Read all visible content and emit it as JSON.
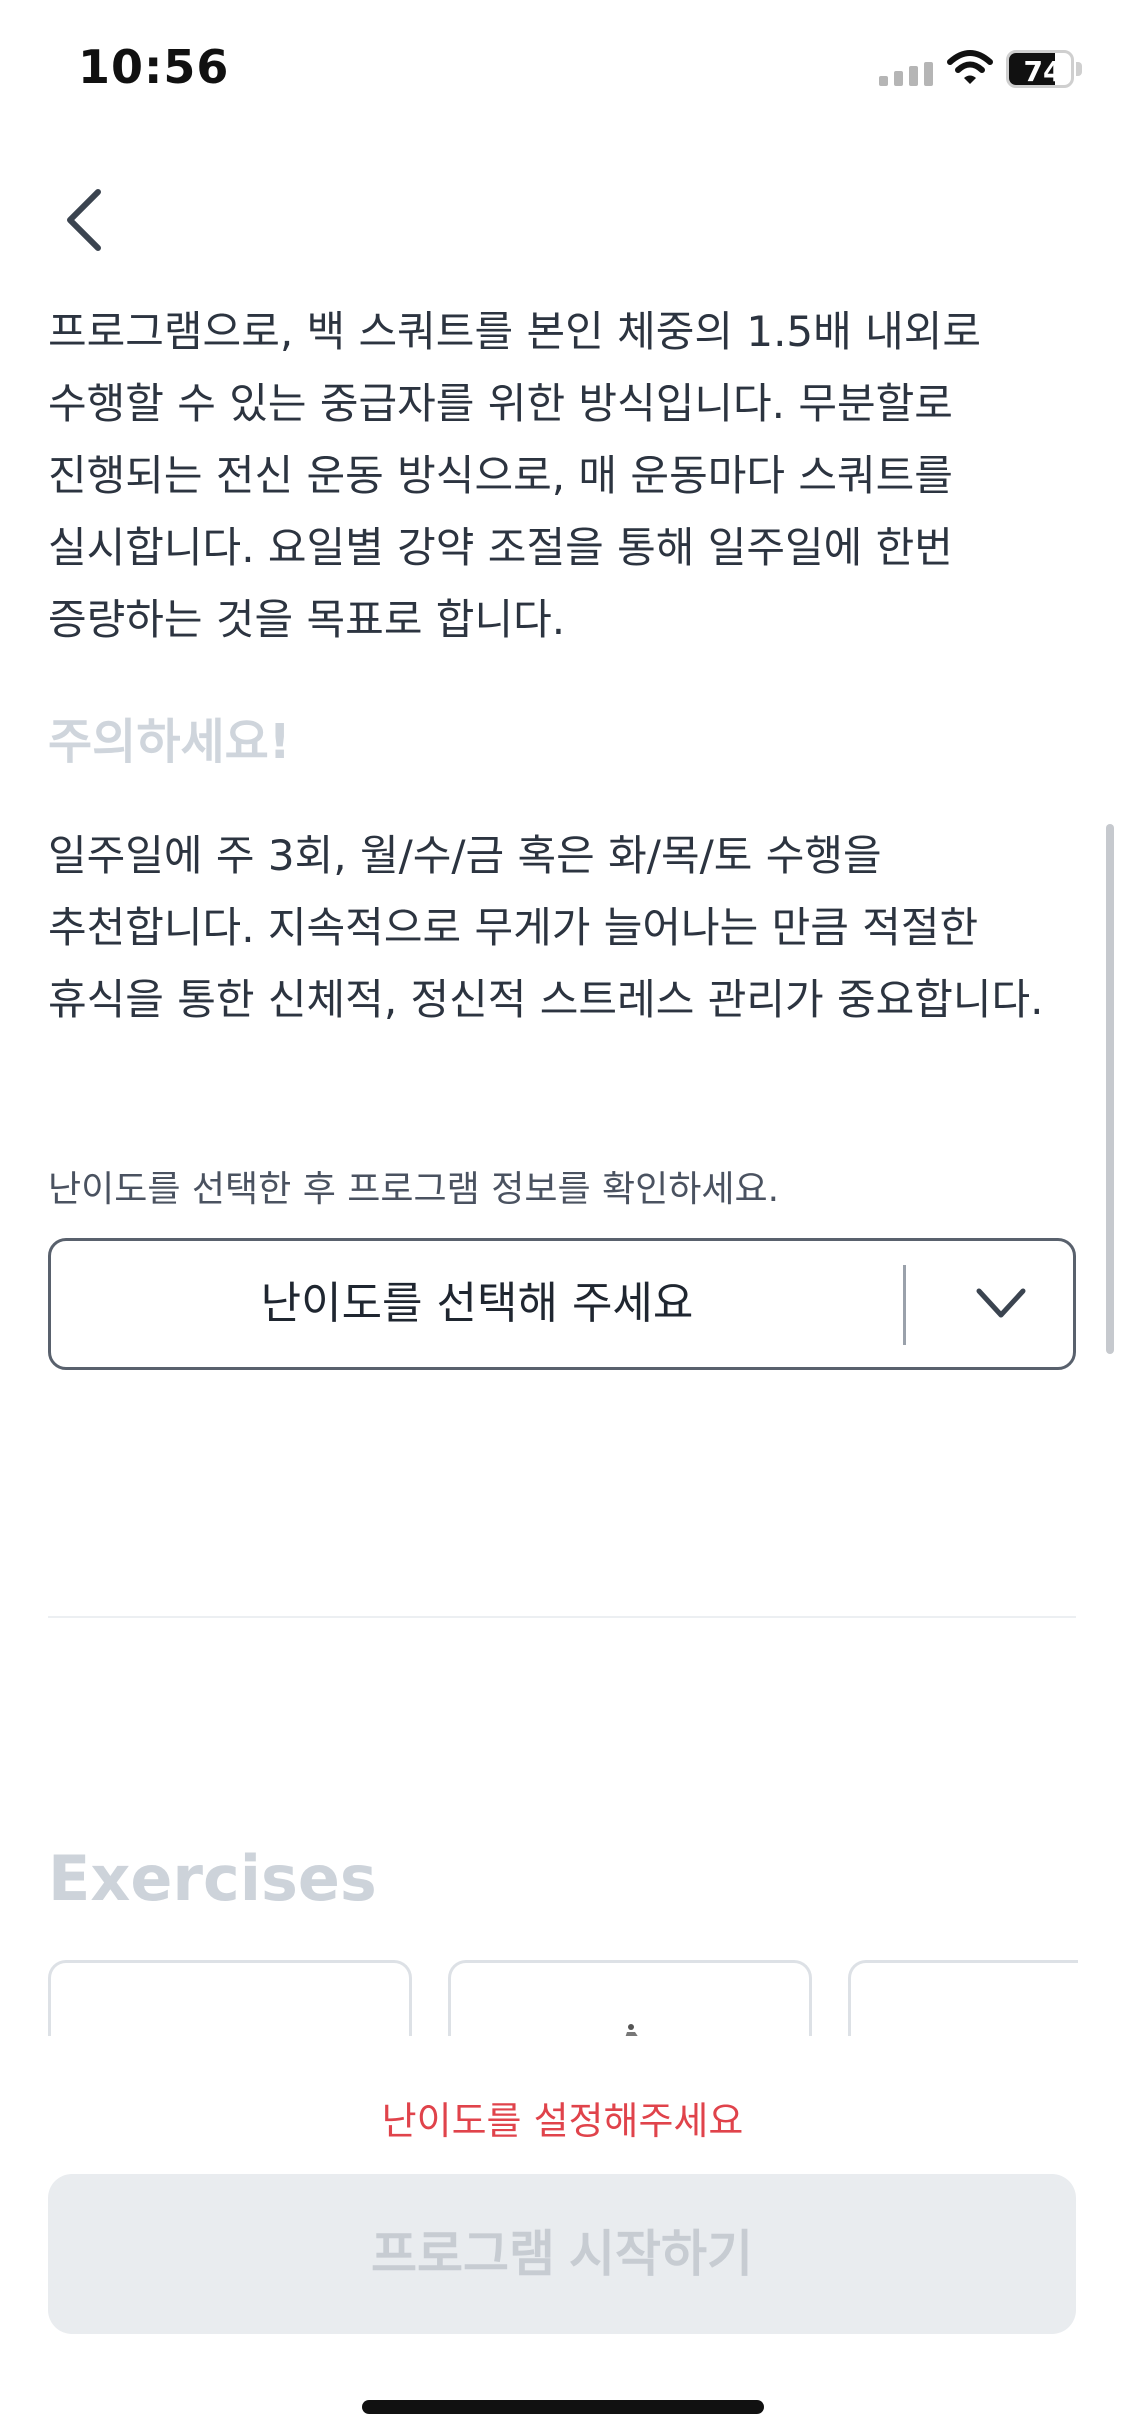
{
  "status_bar": {
    "time": "10:56",
    "battery_percent": 74,
    "battery_label": "74"
  },
  "program": {
    "description": "프로그램으로, 백 스쿼트를 본인 체중의 1.5배 내외로 수행할 수 있는 중급자를 위한 방식입니다. 무분할로 진행되는 전신 운동 방식으로, 매 운동마다 스쿼트를 실시합니다. 요일별 강약 조절을 통해 일주일에 한번 증량하는 것을 목표로 합니다.",
    "warning_title": "주의하세요!",
    "warning_text": "일주일에 주 3회, 월/수/금 혹은 화/목/토 수행을 추천합니다. 지속적으로 무게가 늘어나는 만큼 적절한 휴식을 통한 신체적, 정신적 스트레스 관리가 중요합니다."
  },
  "difficulty": {
    "hint": "난이도를 선택한 후 프로그램 정보를 확인하세요.",
    "placeholder": "난이도를 선택해 주세요"
  },
  "exercises": {
    "title": "Exercises"
  },
  "footer": {
    "error_message": "난이도를 설정해주세요",
    "start_button_label": "프로그램 시작하기"
  },
  "colors": {
    "error": "#e0434b",
    "disabled_button_bg": "#e9ecef",
    "disabled_button_text": "#c7ccd2",
    "border": "#59616d"
  },
  "icons": {
    "back": "chevron-left-icon",
    "dropdown": "chevron-down-icon",
    "signal": "signal-icon",
    "wifi": "wifi-icon"
  }
}
